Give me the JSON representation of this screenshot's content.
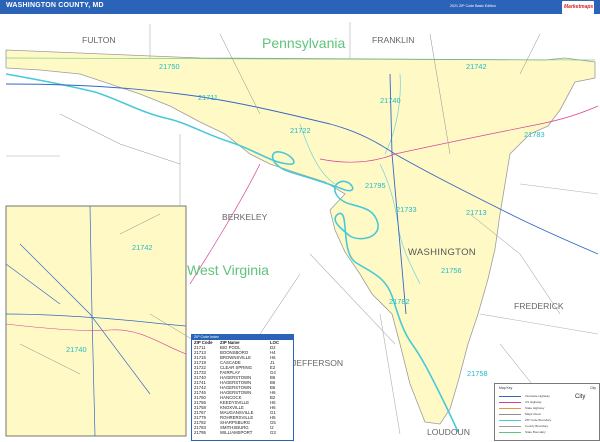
{
  "header": {
    "title": "WASHINGTON COUNTY, MD",
    "edition": "2021 ZIP Code Basic Edition",
    "logo_text": "Marketmaps"
  },
  "colors": {
    "header": "#2b63b8",
    "county_fill": "#fffac5",
    "zip_label": "#22b9c9",
    "state_label": "#5ec47a",
    "river": "#49c9d8",
    "interstate": "#3467c8",
    "highway": "#d8409a",
    "minor_road": "#8f8f8f"
  },
  "map": {
    "state_labels": [
      "Pennsylvania",
      "West Virginia"
    ],
    "region_labels": [
      "FULTON",
      "FRANKLIN",
      "BERKELEY",
      "FREDERICK",
      "JEFFERSON",
      "LOUDOUN"
    ],
    "county_label": "WASHINGTON",
    "zip_labels": [
      "21750",
      "21742",
      "21711",
      "21740",
      "21722",
      "21783",
      "21795",
      "21733",
      "21713",
      "21756",
      "21782",
      "21758"
    ],
    "inset_zip_labels": [
      "21742",
      "21740"
    ]
  },
  "zip_table": {
    "title": "ZIP Code Index",
    "columns": [
      "ZIP Code",
      "ZIP Name",
      "LOC"
    ],
    "rows": [
      [
        "21711",
        "BIG POOL",
        "D2"
      ],
      [
        "21713",
        "BOONSBORO",
        "H4"
      ],
      [
        "21715",
        "BROWNSVILLE",
        "H6"
      ],
      [
        "21719",
        "CASCADE",
        "J1"
      ],
      [
        "21722",
        "CLEAR SPRING",
        "E2"
      ],
      [
        "21733",
        "FAIRPLAY",
        "G4"
      ],
      [
        "21740",
        "HAGERSTOWN",
        "B6"
      ],
      [
        "21741",
        "HAGERSTOWN",
        "B6"
      ],
      [
        "21742",
        "HAGERSTOWN",
        "B6"
      ],
      [
        "21746",
        "HAGERSTOWN",
        "H6"
      ],
      [
        "21750",
        "HANCOCK",
        "B2"
      ],
      [
        "21756",
        "KEEDYSVILLE",
        "H5"
      ],
      [
        "21758",
        "KNOXVILLE",
        "H6"
      ],
      [
        "21767",
        "MAUGANSVILLE",
        "G1"
      ],
      [
        "21779",
        "ROHRERSVILLE",
        "H5"
      ],
      [
        "21782",
        "SHARPSBURG",
        "G5"
      ],
      [
        "21783",
        "SMITHSBURG",
        "I2"
      ],
      [
        "21795",
        "WILLIAMSPORT",
        "G3"
      ]
    ]
  },
  "map_key": {
    "title": "Map Key",
    "scale_label": "City",
    "city_label": "City",
    "items": [
      "Interstate Highway",
      "US Highway",
      "State Highway",
      "Major Road",
      "ZIP Code Boundary",
      "County Boundary",
      "State Boundary"
    ]
  }
}
